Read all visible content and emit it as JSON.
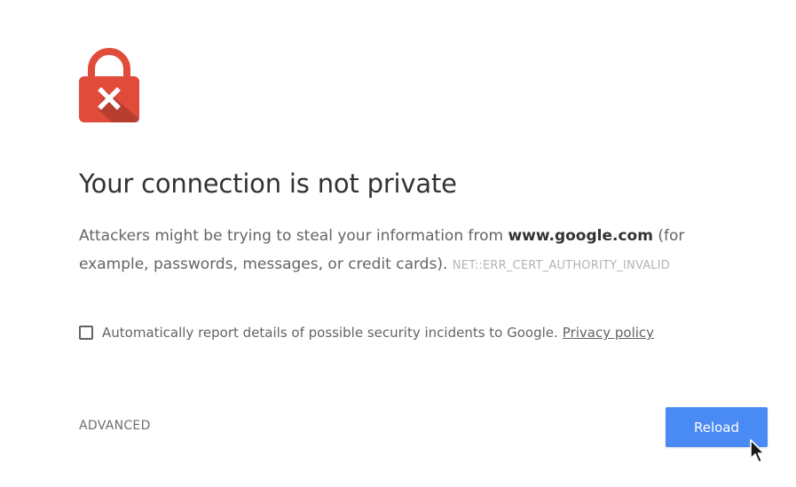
{
  "error": {
    "heading": "Your connection is not private",
    "message_prefix": "Attackers might be trying to steal your information from ",
    "domain": "www.google.com",
    "message_suffix": " (for example, passwords, messages, or credit cards).",
    "error_code": "NET::ERR_CERT_AUTHORITY_INVALID"
  },
  "report": {
    "label": "Automatically report details of possible security incidents to Google.",
    "link_label": "Privacy policy",
    "checked": false
  },
  "actions": {
    "advanced_label": "ADVANCED",
    "reload_label": "Reload"
  },
  "icons": {
    "lock": "lock-error-icon",
    "cursor": "mouse-pointer-icon"
  },
  "colors": {
    "lock_red": "#e04b3a",
    "reload_blue": "#4a8af4",
    "heading_text": "#333333",
    "body_text": "#646464",
    "error_code_text": "#b4b4b4"
  }
}
